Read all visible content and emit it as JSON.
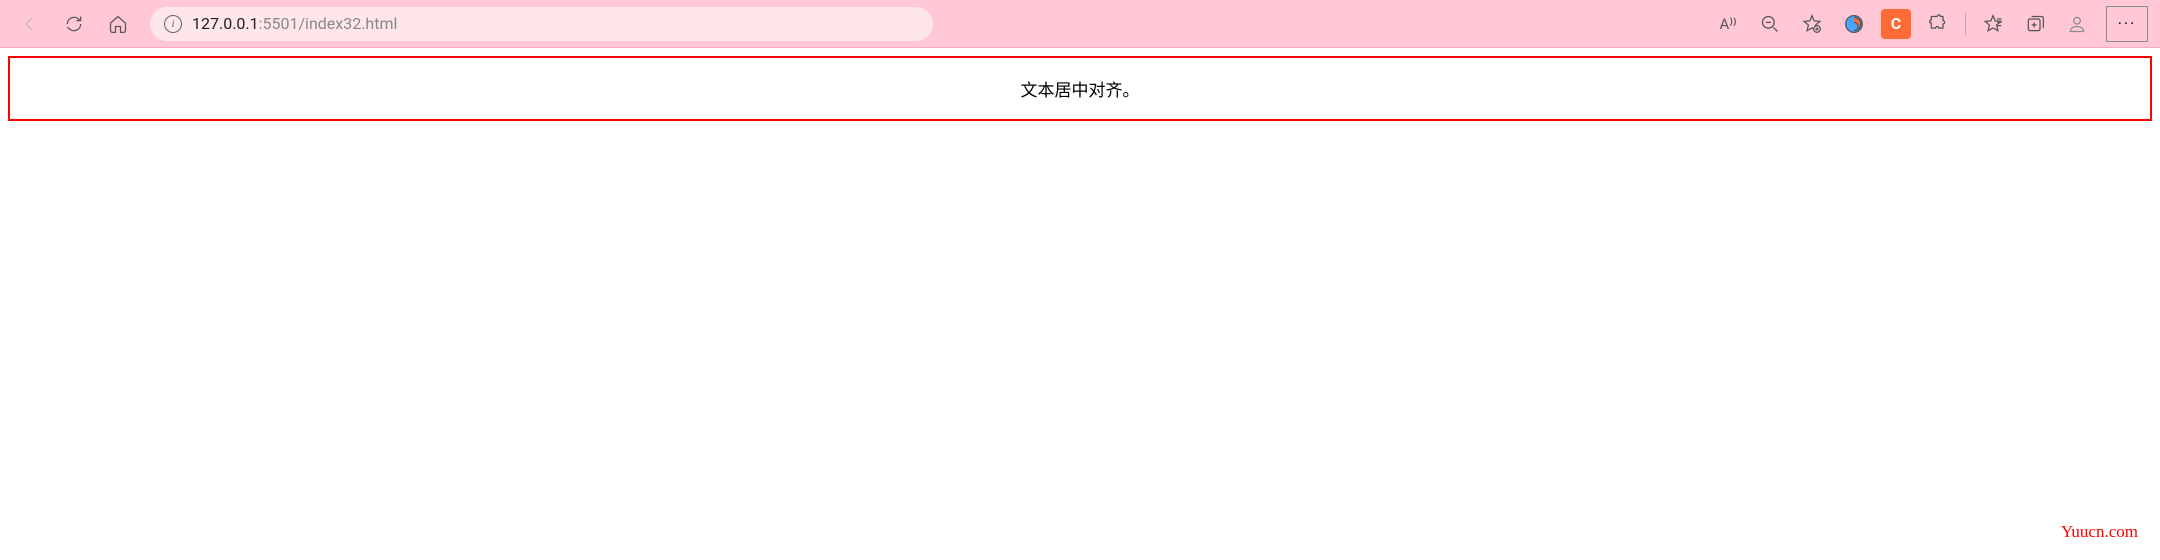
{
  "browser": {
    "url_host": "127.0.0.1",
    "url_path": ":5501/index32.html",
    "read_aloud_label": "A⁾⁾",
    "ext_c_label": "C",
    "more_label": "···"
  },
  "page": {
    "centered_text": "文本居中对齐。"
  },
  "watermark": "Yuucn.com"
}
